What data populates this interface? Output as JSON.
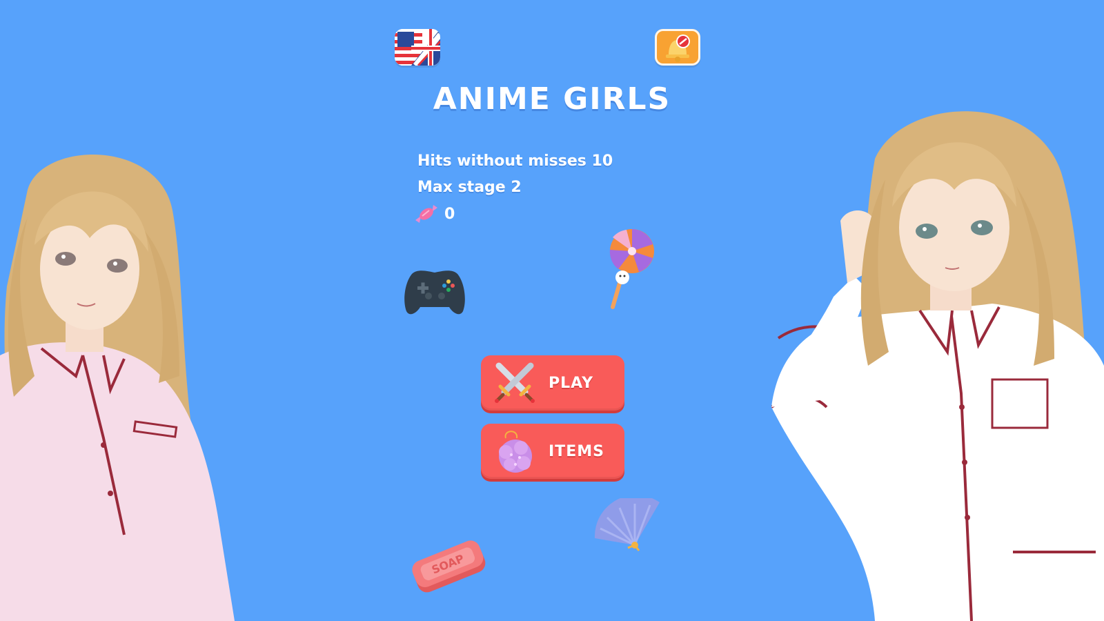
{
  "header": {
    "language_icon": "us-uk-flag-icon",
    "sound_icon": "bell-muted-icon"
  },
  "title": "ANIME GIRLS",
  "stats": {
    "hits": "Hits without misses 10",
    "stage": "Max stage 2",
    "candy_count": "0"
  },
  "buttons": {
    "play": "PLAY",
    "items": "ITEMS"
  },
  "decorations": [
    "gamepad-icon",
    "lollipop-icon",
    "soap-icon",
    "fan-icon",
    "candy-icon",
    "crossed-swords-icon",
    "bath-sponge-icon"
  ],
  "colors": {
    "background": "#57a2fb",
    "button": "#f95b59",
    "sound_button": "#f8a232"
  }
}
